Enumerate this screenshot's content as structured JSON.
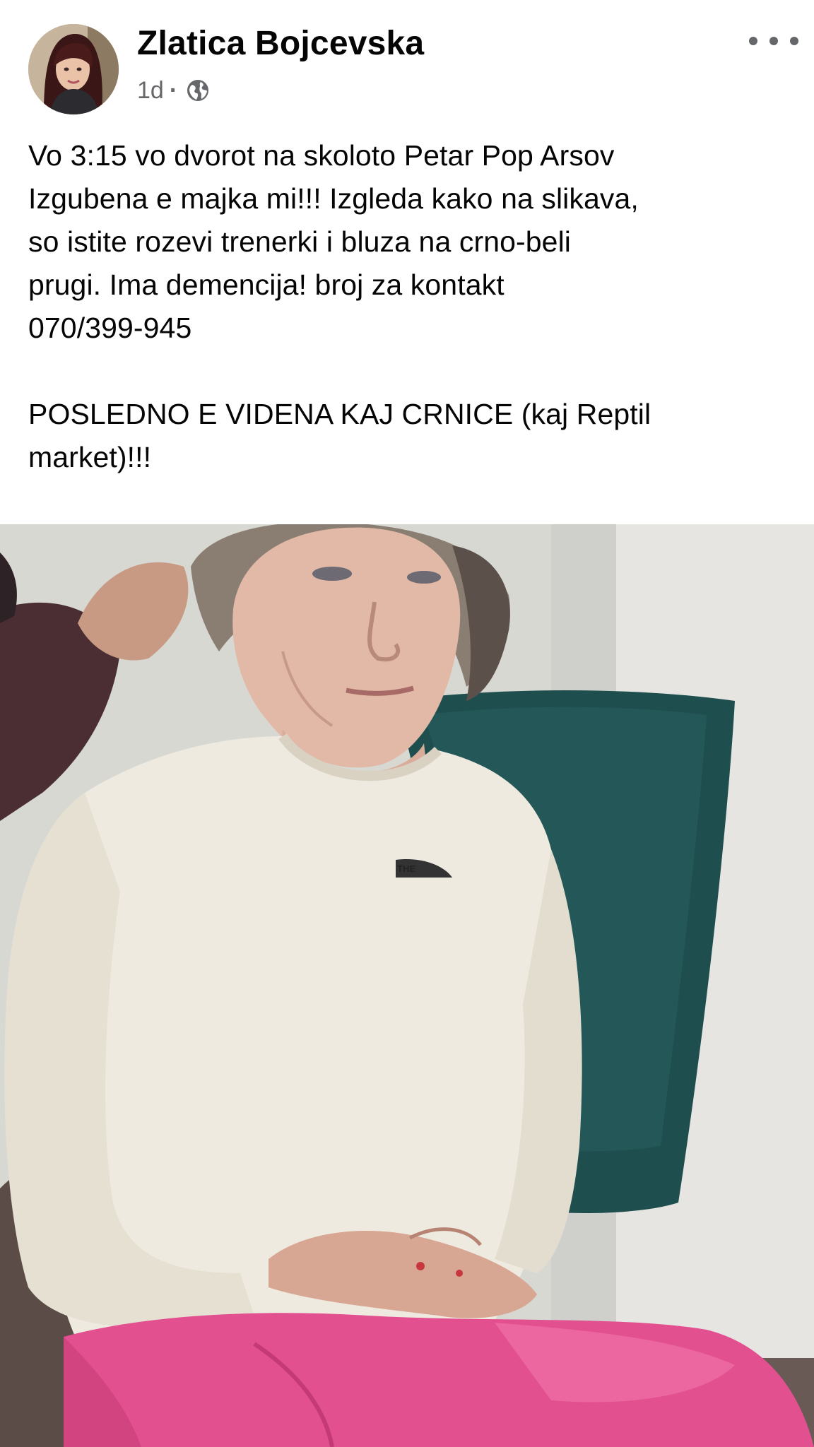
{
  "post": {
    "author": {
      "name": "Zlatica Bojcevska",
      "avatar_icon": "profile-photo"
    },
    "meta": {
      "time": "1d",
      "separator": "·",
      "audience_icon": "globe-icon"
    },
    "more_icon": "more-options-icon",
    "text": {
      "paragraph_1": "Vo 3:15 vo dvorot na skoloto Petar Pop Arsov\nIzgubena e majka mi!!! Izgleda kako na slikava,\nso istite rozevi trenerki i bluza na crno-beli\nprugi. Ima demencija! broj za kontakt\n070/399-945",
      "paragraph_2": "POSLEDNO E VIDENA KAJ CRNICE (kaj Reptil\nmarket)!!!"
    },
    "photo": {
      "alt": "",
      "colors": {
        "sweater": "#efeadf",
        "pants": "#e2508f",
        "pillow": "#1f4e4f",
        "wall": "#dcdcd8",
        "sofa": "#6a5a55"
      }
    }
  },
  "colors": {
    "text_primary": "#050505",
    "text_secondary": "#65676b",
    "background": "#ffffff"
  }
}
